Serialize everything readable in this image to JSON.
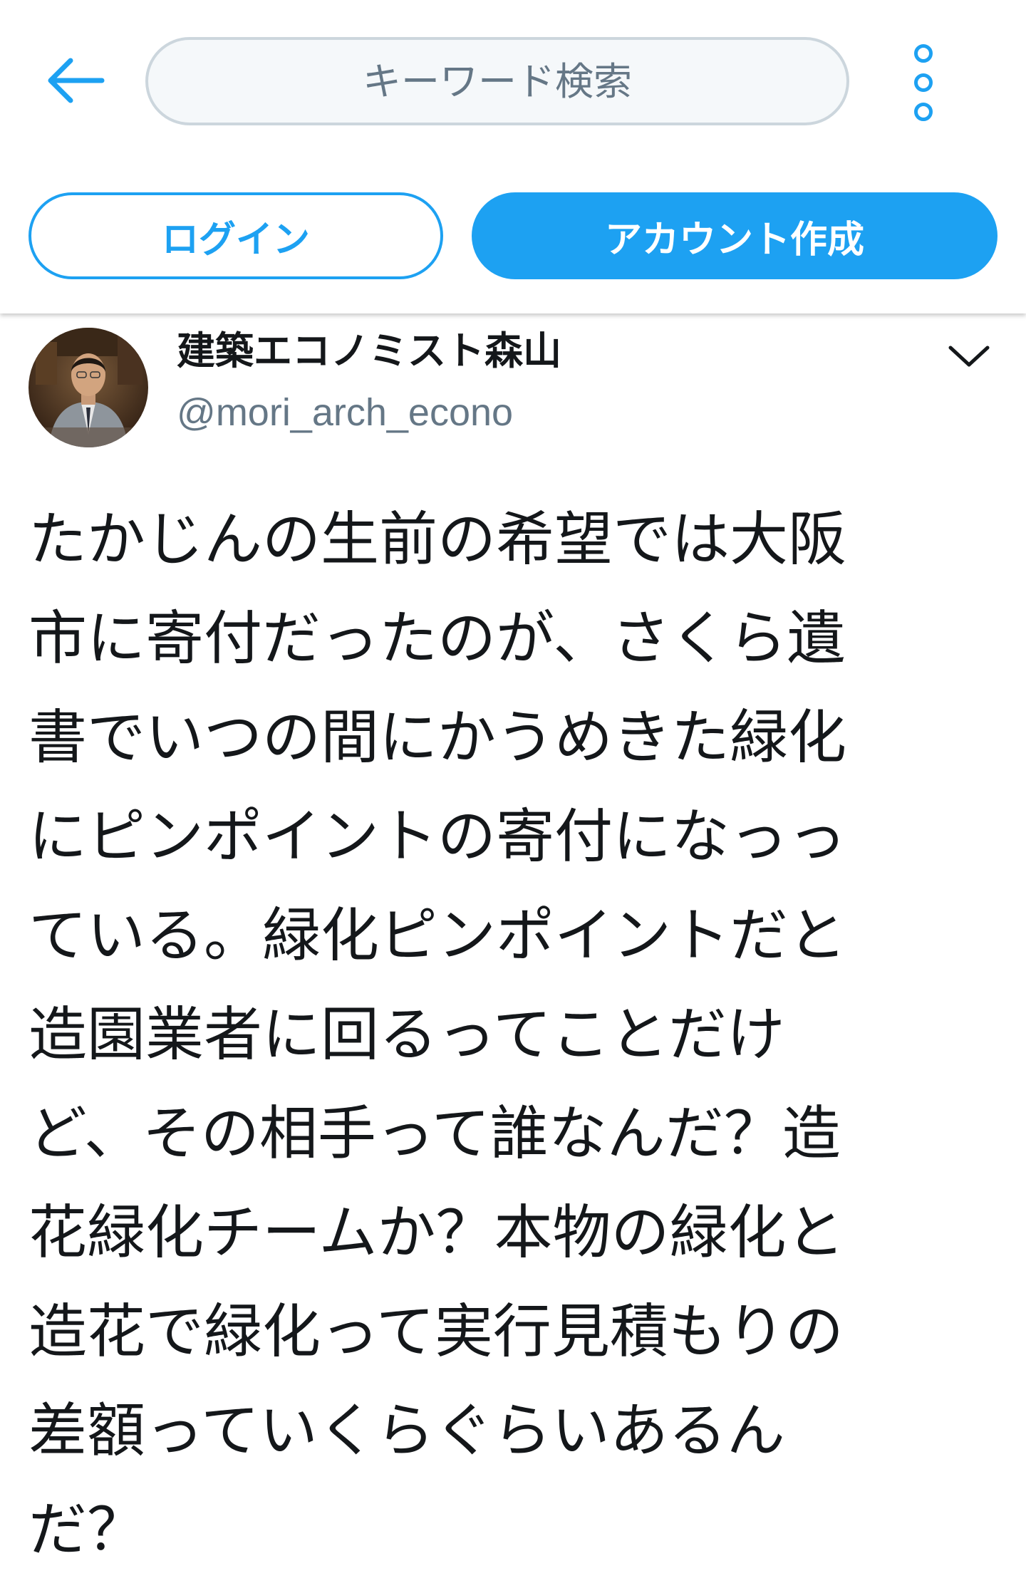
{
  "header": {
    "search_placeholder": "キーワード検索",
    "login_label": "ログイン",
    "signup_label": "アカウント作成",
    "back_icon": "arrow-left-icon",
    "more_icon": "more-vertical-icon"
  },
  "tweet": {
    "display_name": "建築エコノミスト森山",
    "handle": "@mori_arch_econo",
    "text_lines": [
      "たかじんの生前の希望では大阪",
      "市に寄付だったのが、さくら遺",
      "書でいつの間にかうめきた緑化",
      "にピンポイントの寄付になっっ",
      "ている。緑化ピンポイントだと",
      "造園業者に回るってことだけ",
      "ど、その相手って誰なんだ？造",
      "花緑化チームか？本物の緑化と",
      "造花で緑化って実行見積もりの",
      "差額っていくらぐらいあるん",
      "だ？"
    ],
    "menu_icon": "chevron-down-icon"
  },
  "colors": {
    "accent": "#1da1f2",
    "text": "#14171a",
    "secondary_text": "#657786",
    "search_bg": "#f5f8fa",
    "search_border": "#ccd6dd"
  }
}
